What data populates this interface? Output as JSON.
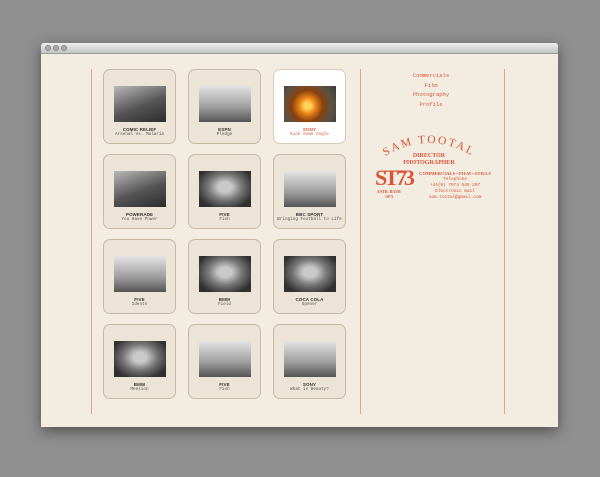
{
  "colors": {
    "accent": "#d9553a",
    "page": "#f3ece1",
    "desktop": "#8f8f8f"
  },
  "nav": [
    "Commercials",
    "Film",
    "Photography",
    "Profile"
  ],
  "logo": {
    "name": "SAM TOOTAL",
    "subtitle_1": "DIRECTOR",
    "subtitle_2": "PHOTOGRAPHER",
    "monogram": "ST73",
    "est_1": "ESTB. BATH",
    "est_2": "1973"
  },
  "contact": {
    "services": "COMMERCIALS • FILM • STILLS",
    "telephone_label": "Telephone",
    "telephone": "+44(0) 7974 549 207",
    "email_label": "Electronic mail",
    "email": "sam.tootal@gmail.com"
  },
  "cards": [
    {
      "brand": "COMIC RELIEF",
      "title": "Arsenal Vs. Malaria",
      "icon": "man-photo"
    },
    {
      "brand": "ESPN",
      "title": "Pledge",
      "icon": "car-photo"
    },
    {
      "brand": "SONY",
      "title": "Kick Some Angle",
      "icon": "burning-car-photo",
      "active": true
    },
    {
      "brand": "POWERADE",
      "title": "You Have Power",
      "icon": "runner-photo"
    },
    {
      "brand": "FIVE",
      "title": "Fish",
      "icon": "portrait-photo"
    },
    {
      "brand": "BBC SPORT",
      "title": "Bringing Football to Life",
      "icon": "building-photo"
    },
    {
      "brand": "FIVE",
      "title": "Idents",
      "icon": "balloons-photo"
    },
    {
      "brand": "BMW",
      "title": "Field",
      "icon": "face-photo"
    },
    {
      "brand": "COCA COLA",
      "title": "Opener",
      "icon": "dog-photo"
    },
    {
      "brand": "BMW",
      "title": "Mension",
      "icon": "eyes-photo"
    },
    {
      "brand": "FIVE",
      "title": "Fish",
      "icon": "rider-photo"
    },
    {
      "brand": "SONY",
      "title": "What is Beauty?",
      "icon": "architecture-photo"
    }
  ]
}
